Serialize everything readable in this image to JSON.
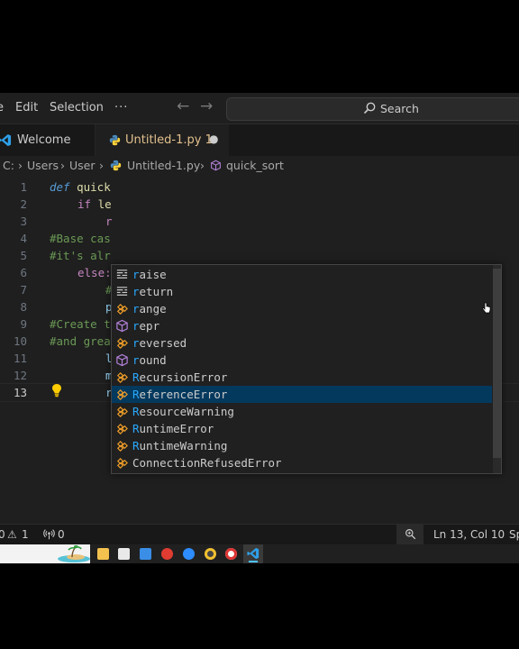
{
  "menu": {
    "items": [
      {
        "label": "e"
      },
      {
        "label": "Edit"
      },
      {
        "label": "Selection"
      },
      {
        "label": "···"
      }
    ]
  },
  "search": {
    "label": "Search"
  },
  "tabs": [
    {
      "label": "Welcome"
    },
    {
      "label": "Untitled-1.py 1",
      "unsaved_dot": "●"
    }
  ],
  "breadcrumb": {
    "parts": [
      "C:",
      "Users",
      "User",
      "Untitled-1.py",
      "quick_sort"
    ],
    "sep": "›"
  },
  "editor": {
    "line_numbers": [
      "1",
      "2",
      "3",
      "4",
      "5",
      "6",
      "7",
      "8",
      "9",
      "10",
      "11",
      "12",
      "13"
    ],
    "lines": [
      {
        "a": "def",
        "b": " quick"
      },
      {
        "a": "if",
        "b": " le"
      },
      {
        "a": "r"
      },
      {
        "a": "#Base cas"
      },
      {
        "a": "#it's alr"
      },
      {
        "a": "else:"
      },
      {
        "a": "#"
      },
      {
        "a": "p"
      },
      {
        "a": "#Create t"
      },
      {
        "a": "#and grea"
      },
      {
        "a": "l"
      },
      {
        "a": "m"
      },
      {
        "a": "r"
      }
    ]
  },
  "suggestions": [
    {
      "label": "raise",
      "kind": "keyword"
    },
    {
      "label": "return",
      "kind": "keyword"
    },
    {
      "label": "range",
      "kind": "class"
    },
    {
      "label": "repr",
      "kind": "function"
    },
    {
      "label": "reversed",
      "kind": "class"
    },
    {
      "label": "round",
      "kind": "function"
    },
    {
      "label": "RecursionError",
      "kind": "class"
    },
    {
      "label": "ReferenceError",
      "kind": "class",
      "selected": true
    },
    {
      "label": "ResourceWarning",
      "kind": "class"
    },
    {
      "label": "RuntimeError",
      "kind": "class"
    },
    {
      "label": "RuntimeWarning",
      "kind": "class"
    },
    {
      "label": "ConnectionRefusedError",
      "kind": "class"
    }
  ],
  "status": {
    "errors": "0",
    "warnings": "1",
    "ports": "0",
    "position": "Ln 13, Col 10",
    "spaces": "Sp"
  },
  "colors": {
    "accent": "#007acc",
    "keyword": "#569cd6",
    "control_keyword": "#c586c0",
    "comment": "#6a9955",
    "match_highlight": "#2aaaff",
    "class_icon": "#ee9d28",
    "method_icon": "#b180d7",
    "selection": "#04395e"
  }
}
